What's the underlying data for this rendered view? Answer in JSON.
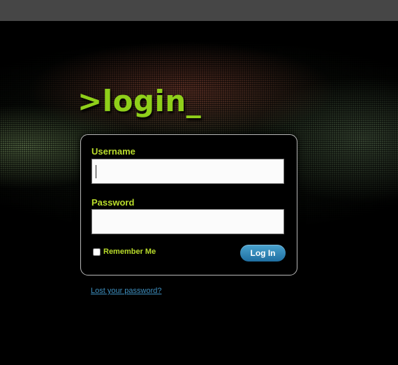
{
  "login": {
    "title": ">login_",
    "username_label": "Username",
    "username_value": "",
    "password_label": "Password",
    "password_value": "",
    "remember_label": "Remember Me",
    "remember_checked": false,
    "submit_label": "Log In",
    "lost_password_link": "Lost your password?"
  },
  "colors": {
    "accent_green": "#8fcf1a",
    "label_green": "#b9dc2b",
    "button_blue": "#1f6fa1",
    "link_blue": "#3e8fbf",
    "topbar_gray": "#464646"
  }
}
